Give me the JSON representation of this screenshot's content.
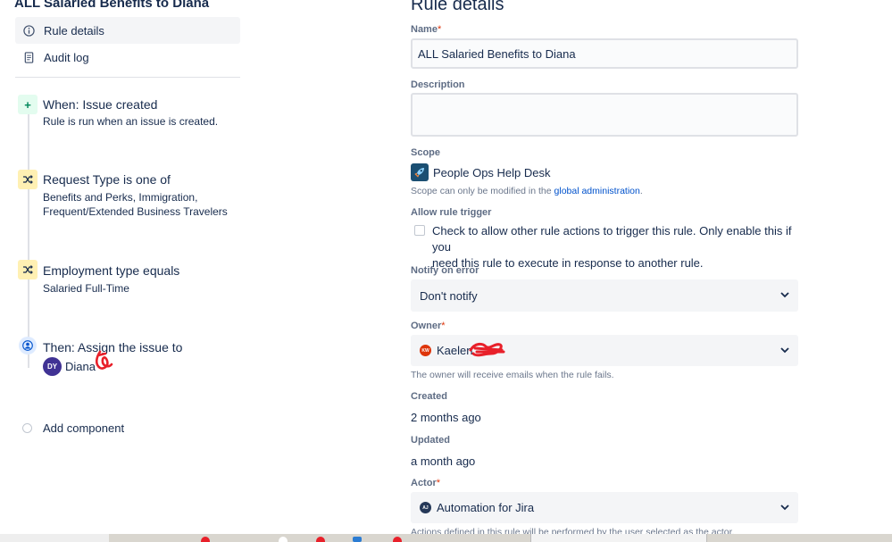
{
  "left": {
    "rule_title": "ALL Salaried Benefits to Diana",
    "nav": [
      {
        "label": "Rule details",
        "icon": "info-icon"
      },
      {
        "label": "Audit log",
        "icon": "document-icon"
      }
    ],
    "steps": [
      {
        "icon": "plus-icon",
        "title": "When: Issue created",
        "subtitle": "Rule is run when an issue is created."
      },
      {
        "icon": "shuffle-icon",
        "title": "Request Type is one of",
        "subtitle": "Benefits and Perks, Immigration,",
        "subtitle2": "Frequent/Extended Business Travelers"
      },
      {
        "icon": "shuffle-icon",
        "title": "Employment type equals",
        "subtitle": "Salaried Full-Time"
      },
      {
        "icon": "assign-user-icon",
        "title": "Then: Assign the issue to"
      }
    ],
    "assignee": {
      "initials": "DY",
      "name": "Diana"
    },
    "add_component": "Add component"
  },
  "form": {
    "heading": "Rule details",
    "name_label": "Name",
    "required_mark": "*",
    "name_value": "ALL Salaried Benefits to Diana",
    "description_label": "Description",
    "description_value": "",
    "scope_label": "Scope",
    "scope_project": "People Ops Help Desk",
    "scope_hint_prefix": "Scope can only be modified in the",
    "scope_hint_link": "global administration",
    "scope_hint_suffix": ".",
    "allow_trigger_label": "Allow rule trigger",
    "allow_trigger_text_1": "Check to allow other rule actions to trigger this rule. Only enable this if you",
    "allow_trigger_text_2": "need this rule to execute in response to another rule.",
    "allow_trigger_checked": false,
    "notify_label": "Notify on error",
    "notify_value": "Don't notify",
    "owner_label": "Owner",
    "owner_initials": "KW",
    "owner_name": "Kaelen",
    "owner_hint": "The owner will receive emails when the rule fails.",
    "created_label": "Created",
    "created_value": "2 months ago",
    "updated_label": "Updated",
    "updated_value": "a month ago",
    "actor_label": "Actor",
    "actor_initials": "AJ",
    "actor_value": "Automation for Jira",
    "actor_hint": "Actions defined in this rule will be performed by the user selected as the actor."
  },
  "colors": {
    "accent": "#0052cc",
    "required": "#de350b",
    "redaction": "#e8202a"
  }
}
